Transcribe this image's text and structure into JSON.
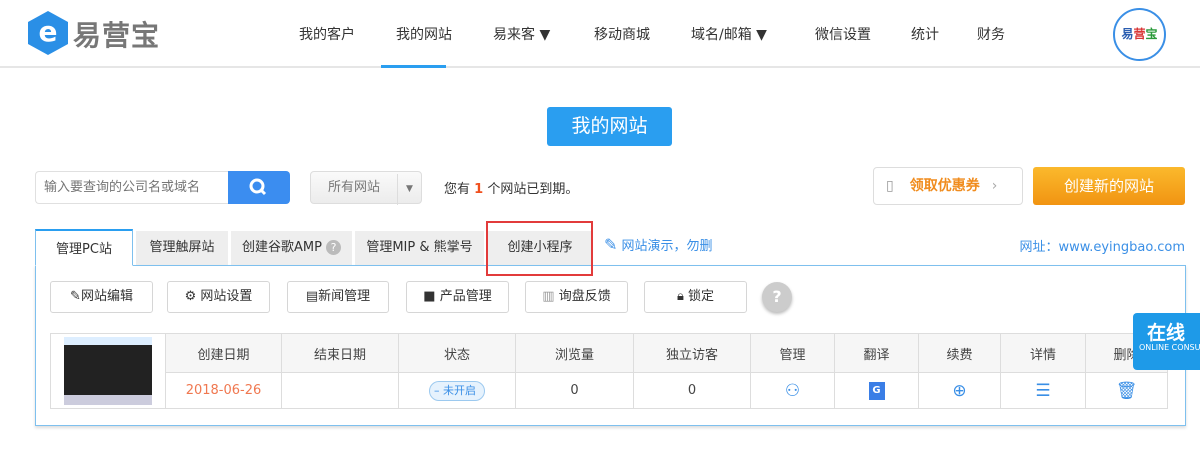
{
  "header": {
    "logo_text": "易营宝",
    "nav": [
      "我的客户",
      "我的网站",
      "易来客 ▼",
      "移动商城",
      "域名/邮箱 ▼",
      "微信设置",
      "统计",
      "财务"
    ],
    "avatar_text": [
      "易",
      "营",
      "宝"
    ]
  },
  "page_title": "我的网站",
  "search": {
    "placeholder": "输入要查询的公司名或域名"
  },
  "filter": {
    "selected": "所有网站"
  },
  "notice": {
    "prefix": "您有 ",
    "count": "1",
    "suffix": " 个网站已到期。"
  },
  "coupon": {
    "label": "领取优惠券"
  },
  "create_label": "创建新的网站",
  "tabs": [
    "管理PC站",
    "管理触屏站",
    "创建谷歌AMP",
    "管理MIP & 熊掌号",
    "创建小程序"
  ],
  "demo_link": "网站演示，勿删",
  "site_url": "网址：www.eyingbao.com",
  "actions": [
    "网站编辑",
    "网站设置",
    "新闻管理",
    "产品管理",
    "询盘反馈",
    "锁定"
  ],
  "table": {
    "headers": [
      "创建日期",
      "结束日期",
      "状态",
      "浏览量",
      "独立访客",
      "管理",
      "翻译",
      "续费",
      "详情",
      "删除"
    ],
    "row": {
      "created": "2018-06-26",
      "ended": "",
      "status": "未开启",
      "views": "0",
      "visitors": "0"
    }
  },
  "chat": {
    "title": "在线",
    "subtitle": "ONLINE CONSULT"
  },
  "colors": {
    "accent": "#2a9ef0",
    "orange": "#f19412",
    "highlight": "#e23b3b"
  }
}
